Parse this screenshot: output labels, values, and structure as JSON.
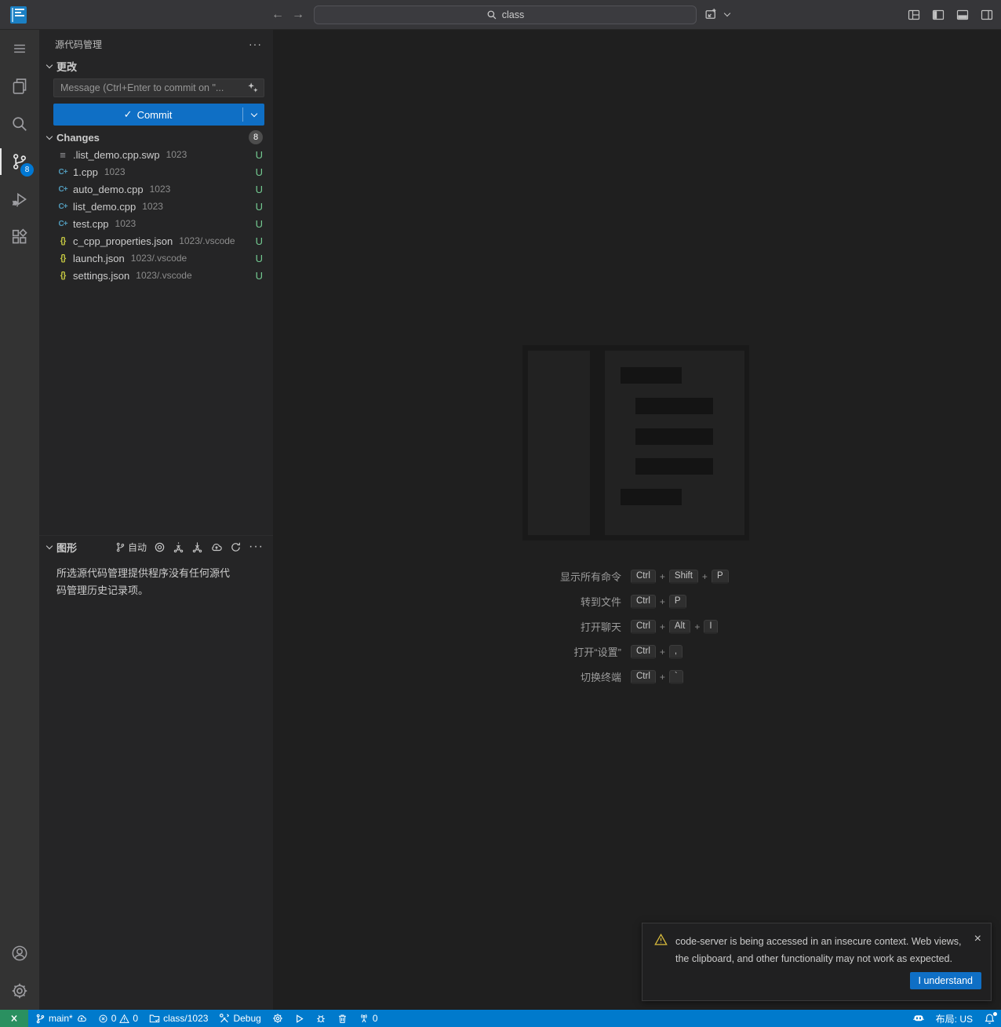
{
  "title_bar": {
    "search_value": "class",
    "back": "←",
    "forward": "→"
  },
  "activity_bar": {
    "source_control_badge": "8"
  },
  "sidebar": {
    "title": "源代码管理",
    "changes_section_label": "更改",
    "commit_placeholder": "Message (Ctrl+Enter to commit on \"...",
    "commit_label": "Commit",
    "commit_check": "✓",
    "changes_header": "Changes",
    "changes_badge": "8",
    "more_label": "···",
    "icon_glyphs": {
      "cpp": "C+",
      "json": "{}",
      "text": "≡"
    },
    "files": [
      {
        "name": ".list_demo.cpp.swp",
        "desc": "1023",
        "status": "U",
        "icon": "text"
      },
      {
        "name": "1.cpp",
        "desc": "1023",
        "status": "U",
        "icon": "cpp"
      },
      {
        "name": "auto_demo.cpp",
        "desc": "1023",
        "status": "U",
        "icon": "cpp"
      },
      {
        "name": "list_demo.cpp",
        "desc": "1023",
        "status": "U",
        "icon": "cpp"
      },
      {
        "name": "test.cpp",
        "desc": "1023",
        "status": "U",
        "icon": "cpp"
      },
      {
        "name": "c_cpp_properties.json",
        "desc": "1023/.vscode",
        "status": "U",
        "icon": "json"
      },
      {
        "name": "launch.json",
        "desc": "1023/.vscode",
        "status": "U",
        "icon": "json"
      },
      {
        "name": "settings.json",
        "desc": "1023/.vscode",
        "status": "U",
        "icon": "json"
      }
    ],
    "graph": {
      "label": "图形",
      "auto_label": "自动",
      "more_label": "···",
      "empty_message": "所选源代码管理提供程序没有任何源代码管理历史记录项。"
    }
  },
  "editor": {
    "plus": "+",
    "shortcuts": [
      {
        "label": "显示所有命令",
        "keys": [
          "Ctrl",
          "Shift",
          "P"
        ]
      },
      {
        "label": "转到文件",
        "keys": [
          "Ctrl",
          "P"
        ]
      },
      {
        "label": "打开聊天",
        "keys": [
          "Ctrl",
          "Alt",
          "I"
        ]
      },
      {
        "label": "打开“设置”",
        "keys": [
          "Ctrl",
          ","
        ]
      },
      {
        "label": "切换终端",
        "keys": [
          "Ctrl",
          "`"
        ]
      }
    ]
  },
  "notification": {
    "message": "code-server is being accessed in an insecure context. Web views, the clipboard, and other functionality may not work as expected.",
    "close": "×",
    "button_label": "I understand"
  },
  "status_bar": {
    "branch_label": "main*",
    "error_count": "0",
    "warning_count": "0",
    "workspace_label": "class/1023",
    "debug_label": "Debug",
    "ports_count": "0",
    "keyboard_layout_label": "布局: US"
  },
  "colors": {
    "status_bar_blue": "#007acc",
    "remote_green": "#2a9060",
    "button_blue": "#0f6fc5",
    "badge_blue": "#0078d4",
    "untracked_green": "#73c991",
    "warning_yellow": "#d7ba3c",
    "cpp_icon": "#519aba",
    "json_icon": "#c5c842",
    "editor_bg": "#1f1f1f",
    "sidebar_bg": "#252526",
    "activitybar_bg": "#333333",
    "titlebar_bg": "#363639"
  }
}
